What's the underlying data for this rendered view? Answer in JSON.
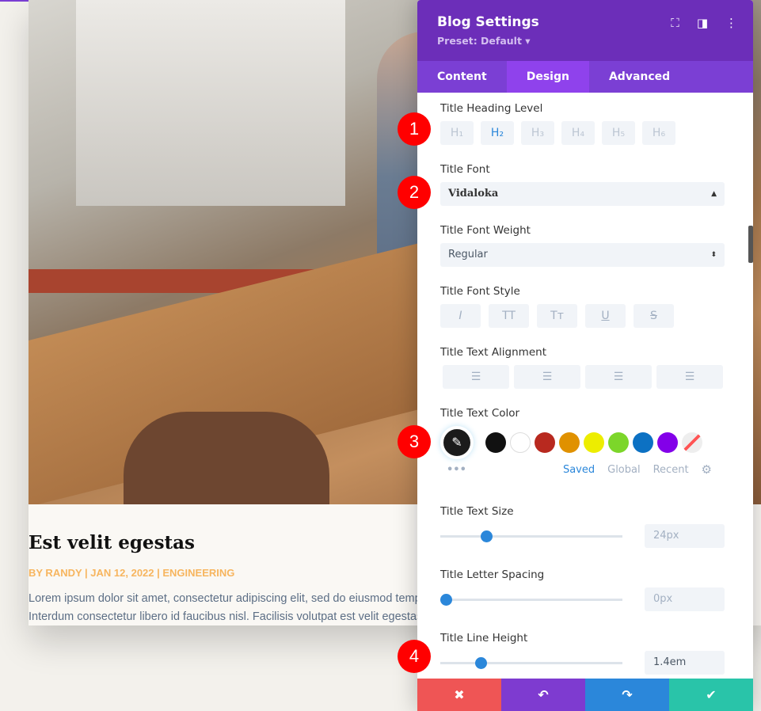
{
  "article": {
    "title": "Est velit egestas",
    "meta": "BY RANDY | JAN 12, 2022 | ENGINEERING",
    "lines": [
      "Lorem ipsum dolor sit amet, consectetur adipiscing elit, sed do eiusmod tempor",
      "Interdum consectetur libero id faucibus nisl. Facilisis volutpat est velit egestas d"
    ]
  },
  "panel": {
    "title": "Blog Settings",
    "preset": "Preset: Default ▾",
    "icons": [
      "fullscreen-icon",
      "split-view-icon",
      "more-vertical-icon"
    ],
    "tabs": [
      "Content",
      "Design",
      "Advanced"
    ],
    "active_tab": "Design",
    "heading_level": {
      "label": "Title Heading Level",
      "options": [
        "H₁",
        "H₂",
        "H₃",
        "H₄",
        "H₅",
        "H₆"
      ],
      "selected": "H2"
    },
    "font": {
      "label": "Title Font",
      "value": "Vidaloka"
    },
    "weight": {
      "label": "Title Font Weight",
      "value": "Regular"
    },
    "style": {
      "label": "Title Font Style",
      "options": [
        "I",
        "TT",
        "Tт",
        "U",
        "S"
      ]
    },
    "alignment": {
      "label": "Title Text Alignment",
      "options": [
        "left",
        "center",
        "right",
        "justify"
      ]
    },
    "color": {
      "label": "Title Text Color",
      "current": "#1b1b1b",
      "swatches": [
        "#111111",
        "#ffffff",
        "#b8291f",
        "#e09100",
        "#eded00",
        "#7cd62a",
        "#0c71c3",
        "#8300e9"
      ],
      "more": "•••",
      "tabs": [
        "Saved",
        "Global",
        "Recent"
      ],
      "active": "Saved"
    },
    "size": {
      "label": "Title Text Size",
      "value": "24px",
      "fraction": 0.25
    },
    "spacing": {
      "label": "Title Letter Spacing",
      "value": "0px",
      "fraction": 0.03
    },
    "line_height": {
      "label": "Title Line Height",
      "value": "1.4em",
      "fraction": 0.22
    },
    "footer": [
      {
        "name": "cancel",
        "glyph": "✖",
        "color": "#ef5555"
      },
      {
        "name": "undo",
        "glyph": "↶",
        "color": "#7e3bd0"
      },
      {
        "name": "redo",
        "glyph": "↷",
        "color": "#2b87da"
      },
      {
        "name": "save",
        "glyph": "✔",
        "color": "#29c4a9"
      }
    ]
  },
  "badges": [
    "1",
    "2",
    "3",
    "4"
  ],
  "accent": "#2b87da"
}
